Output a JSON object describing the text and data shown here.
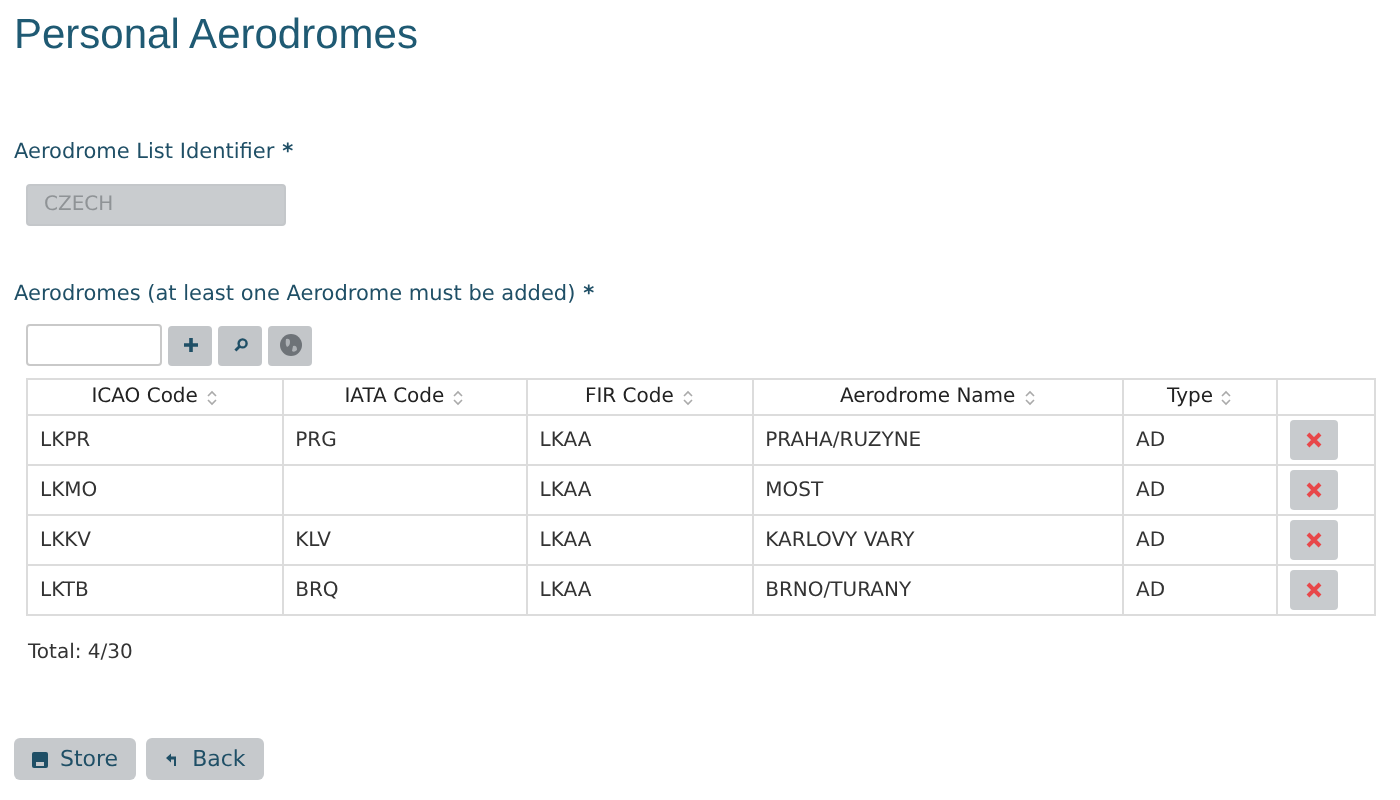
{
  "title": "Personal Aerodromes",
  "list_identifier": {
    "label": "Aerodrome List Identifier",
    "required_mark": "*",
    "value": "CZECH",
    "disabled": true
  },
  "aerodromes": {
    "label": "Aerodromes (at least one Aerodrome must be added)",
    "required_mark": "*",
    "table": {
      "columns": [
        "ICAO Code",
        "IATA Code",
        "FIR Code",
        "Aerodrome Name",
        "Type"
      ],
      "rows": [
        {
          "cells": [
            "LKPR",
            "PRG",
            "LKAA",
            "PRAHA/RUZYNE",
            "AD"
          ]
        },
        {
          "cells": [
            "LKMO",
            "",
            "LKAA",
            "MOST",
            "AD"
          ]
        },
        {
          "cells": [
            "LKKV",
            "KLV",
            "LKAA",
            "KARLOVY VARY",
            "AD"
          ]
        },
        {
          "cells": [
            "LKTB",
            "BRQ",
            "LKAA",
            "BRNO/TURANY",
            "AD"
          ]
        }
      ]
    },
    "total": "Total: 4/30"
  },
  "buttons": [
    {
      "kind": "store",
      "label": "Store"
    },
    {
      "kind": "back",
      "label": "Back"
    }
  ]
}
